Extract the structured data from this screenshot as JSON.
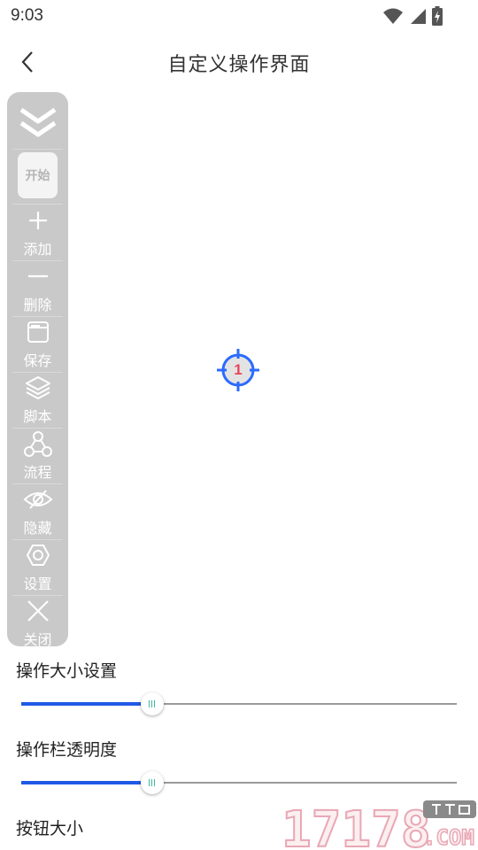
{
  "status_bar": {
    "time": "9:03"
  },
  "app_bar": {
    "title": "自定义操作界面"
  },
  "toolbar": {
    "start_label": "开始",
    "items": [
      {
        "label": "添加",
        "icon": "plus-icon"
      },
      {
        "label": "删除",
        "icon": "minus-icon"
      },
      {
        "label": "保存",
        "icon": "save-icon"
      },
      {
        "label": "脚本",
        "icon": "layers-icon"
      },
      {
        "label": "流程",
        "icon": "flow-icon"
      },
      {
        "label": "隐藏",
        "icon": "eye-off-icon"
      },
      {
        "label": "设置",
        "icon": "gear-icon"
      },
      {
        "label": "关闭",
        "icon": "close-icon"
      }
    ]
  },
  "crosshair": {
    "number": "1"
  },
  "settings": {
    "action_size_label": "操作大小设置",
    "action_size_value": 0.3,
    "toolbar_opacity_label": "操作栏透明度",
    "toolbar_opacity_value": 0.3,
    "button_size_label": "按钮大小"
  },
  "colors": {
    "accent": "#1f59e6",
    "crosshair": "#2b6bff",
    "crosshair_number": "#e8455a",
    "toolbar_bg": "#c9c9c9"
  }
}
